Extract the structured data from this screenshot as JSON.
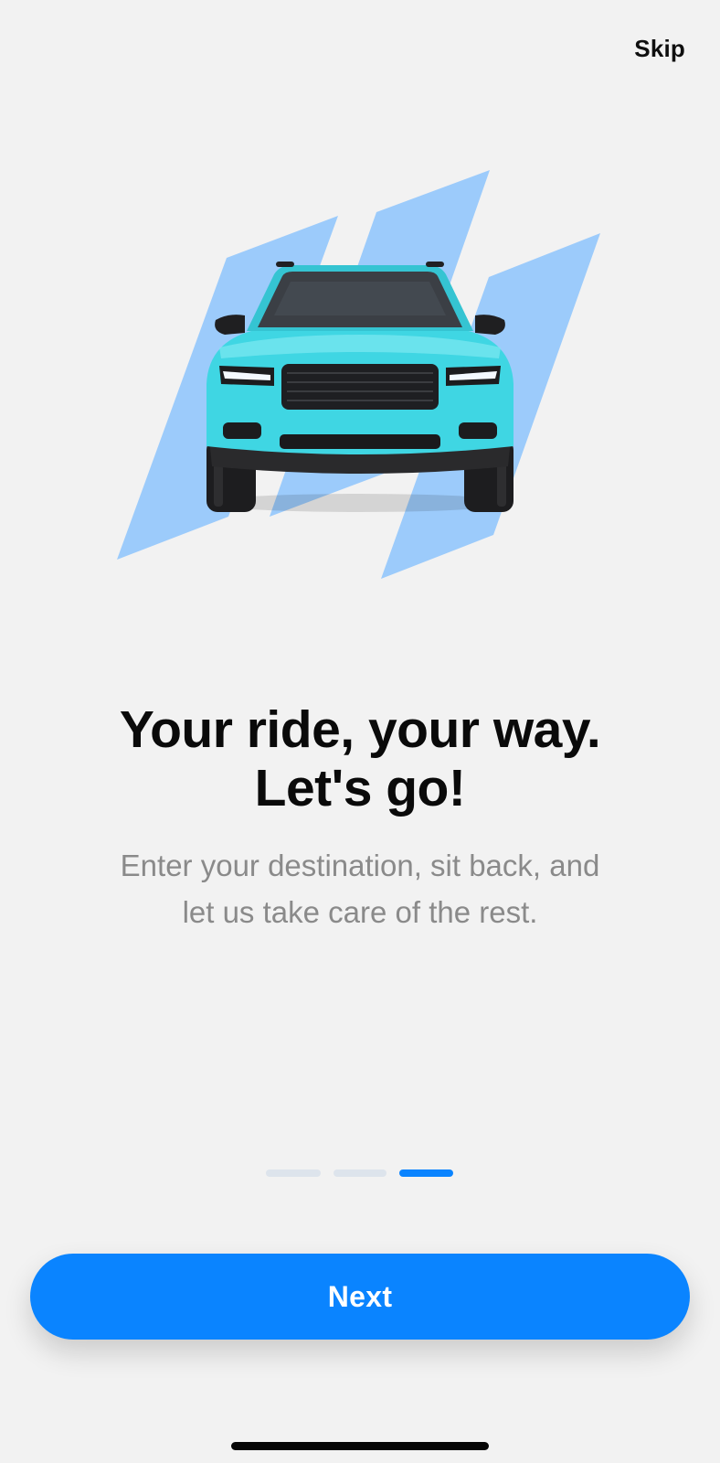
{
  "header": {
    "skip_label": "Skip"
  },
  "onboarding": {
    "title_line1": "Your ride, your way.",
    "title_line2": "Let's go!",
    "subtitle_line1": "Enter your destination, sit back, and",
    "subtitle_line2": "let us take care of the rest.",
    "current_page": 3,
    "total_pages": 3
  },
  "actions": {
    "next_label": "Next"
  },
  "colors": {
    "accent": "#0a84ff",
    "car_body": "#3fd6e3",
    "stripes": "#9ccbfb",
    "background": "#f2f2f2"
  }
}
